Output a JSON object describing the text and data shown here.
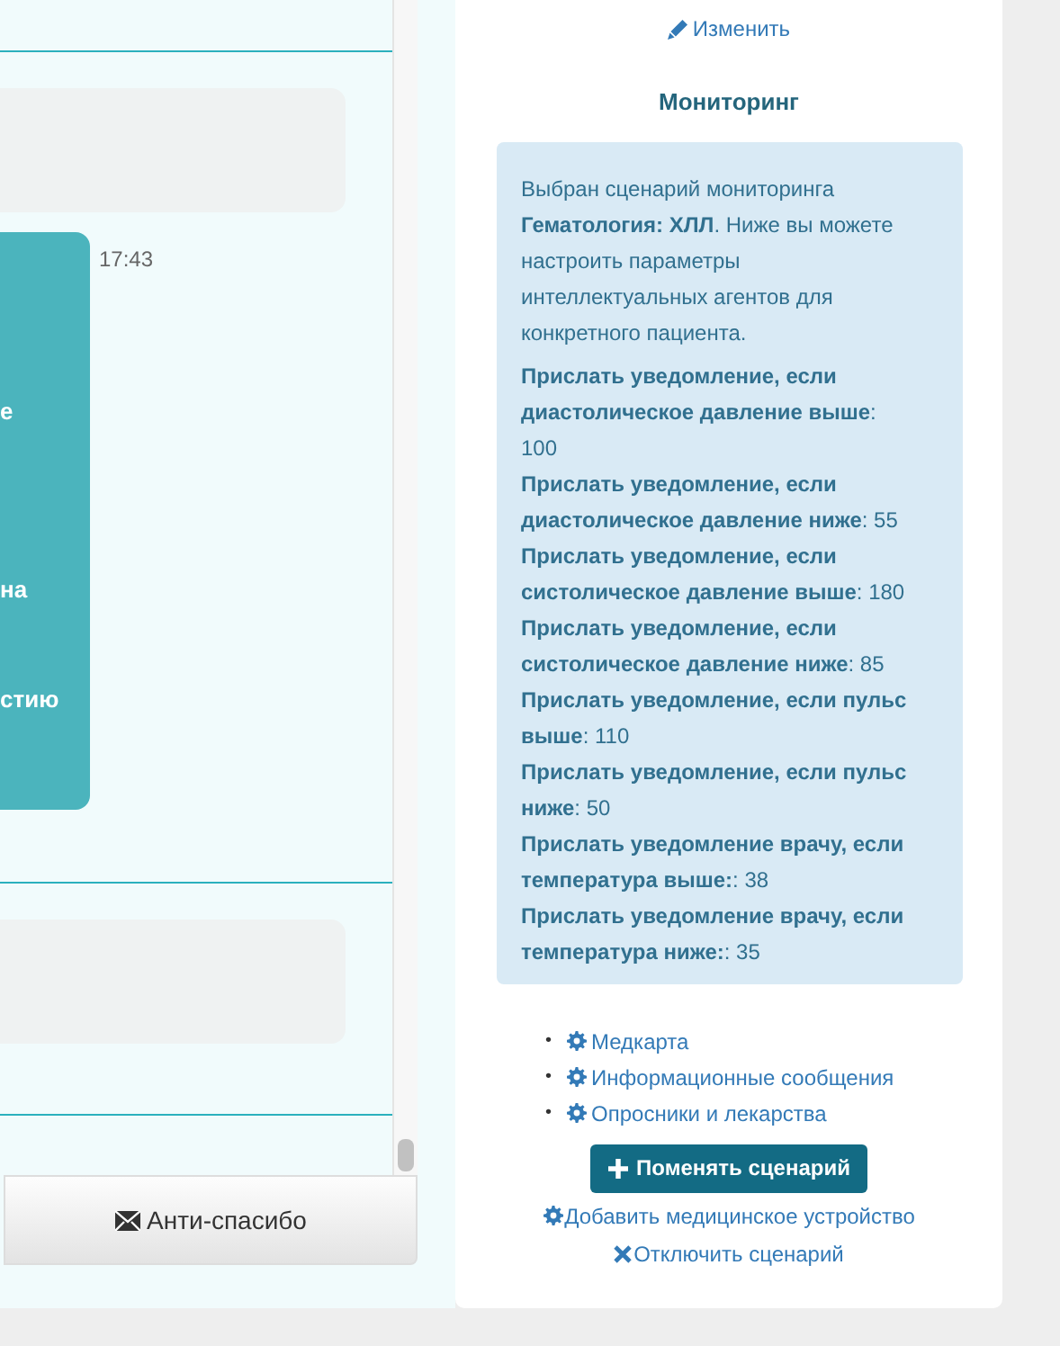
{
  "chat": {
    "messages": [
      {
        "kind": "incoming"
      },
      {
        "kind": "outgoing",
        "time": "17:43",
        "lines": [
          "е",
          "на",
          "стию"
        ]
      },
      {
        "kind": "incoming"
      }
    ]
  },
  "chat_buttons": [
    {
      "label": "Анти-спасибо"
    }
  ],
  "edit_link": "Изменить",
  "monitoring": {
    "title": "Мониторинг",
    "intro": "Выбран сценарий мониторинга **Гематология: ХЛЛ**. Ниже вы можете настроить параметры интеллектуальных агентов для конкретного пациента.",
    "rules": [
      "**Прислать уведомление, если диастолическое давление выше**: 100",
      "**Прислать уведомление, если диастолическое давление ниже**: 55",
      "**Прислать уведомление, если систолическое давление выше**: 180",
      "**Прислать уведомление, если систолическое давление ниже**: 85",
      "**Прислать уведомление, если пульс выше**: 110",
      "**Прислать уведомление, если пульс ниже**: 50",
      "**Прислать уведомление врачу, если температура выше:**: 38",
      "**Прислать уведомление врачу, если температура ниже:**: 35"
    ]
  },
  "settings_links": [
    {
      "marker": "•",
      "label": "Медкарта"
    },
    {
      "marker": "•",
      "label": "Информационные сообщения"
    },
    {
      "marker": "•",
      "label": "Опросники и лекарства"
    }
  ],
  "change_button": "Поменять сценарий",
  "add_device_link": "Добавить медицинское устройство",
  "disable_link": "Отключить сценарий"
}
